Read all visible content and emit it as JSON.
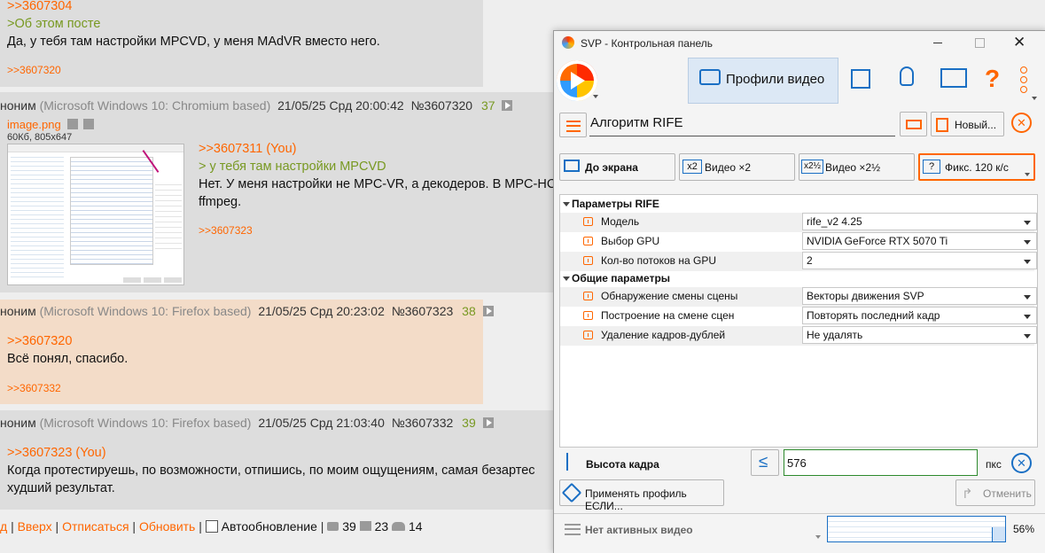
{
  "thread": {
    "post0": {
      "ref_top": ">>3607304",
      "quote_label": ">Об этом посте",
      "text": "Да, у тебя там настройки MPCVD, у меня MAdVR вместо него.",
      "reply_ref": ">>3607320"
    },
    "post1": {
      "author": "нонимм",
      "author_display": "ноним",
      "os": "(Microsoft Windows 10: Chromium based)",
      "date": "21/05/25 Срд 20:00:42",
      "num": "№3607320",
      "replies": "37",
      "file_name": "image.png",
      "file_meta": "60Кб, 805x647",
      "ref": ">>3607311 (You)",
      "quote": "> у тебя там настройки MPCVD",
      "text1": "Нет. У меня настройки не MPC-VR, а декодеров. В MPC-HC",
      "text2": "ffmpeg.",
      "reply_ref": ">>3607323"
    },
    "post2": {
      "author_display": "ноним",
      "os": "(Microsoft Windows 10: Firefox based)",
      "date": "21/05/25 Срд 20:23:02",
      "num": "№3607323",
      "replies": "38",
      "ref": ">>3607320",
      "text": "Всё понял, спасибо.",
      "reply_ref": ">>3607332"
    },
    "post3": {
      "author_display": "ноним",
      "os": "(Microsoft Windows 10: Firefox based)",
      "date": "21/05/25 Срд 21:03:40",
      "num": "№3607332",
      "replies": "39",
      "ref": ">>3607323 (You)",
      "text1": "Когда протестируешь, по возможности, отпишись, по моим ощущениям, самая безартес",
      "text2": "худший результат."
    },
    "footer": {
      "first": "д",
      "up": "Вверх",
      "unsubscribe": "Отписаться",
      "refresh": "Обновить",
      "autoupdate": "Автообновление",
      "posts_count": "39",
      "images_count": "23",
      "users_count": "14"
    }
  },
  "svp": {
    "title": "SVP - Контрольная панель",
    "tab_active": "Профили видео",
    "profile_name": "Алгоритм RIFE",
    "new_button": "Новый...",
    "modes": [
      "До экрана",
      "Видео ×2",
      "Видео ×2½",
      "Фикс. 120 к/с"
    ],
    "mode_badges": [
      "",
      "x2",
      "x2½",
      "?"
    ],
    "section1": "Параметры RIFE",
    "section2": "Общие параметры",
    "rows": [
      {
        "label": "Модель",
        "value": "rife_v2 4.25"
      },
      {
        "label": "Выбор GPU",
        "value": "NVIDIA GeForce RTX 5070 Ti"
      },
      {
        "label": "Кол-во потоков на GPU",
        "value": "2"
      },
      {
        "label": "Обнаружение смены сцены",
        "value": "Векторы движения SVP"
      },
      {
        "label": "Построение на смене сцен",
        "value": "Повторять последний кадр"
      },
      {
        "label": "Удаление кадров-дублей",
        "value": "Не удалять"
      }
    ],
    "frame_height_label": "Высота кадра",
    "frame_height_value": "576",
    "frame_height_unit": "пкс",
    "apply_if": "Применять профиль ЕСЛИ...",
    "cancel": "Отменить",
    "status": "Нет активных видео",
    "cpu_percent": "56%",
    "cpu_fraction": 0.56,
    "colors": {
      "accent": "#ff6600",
      "tab_bg": "#dce8f5",
      "green_border": "#2d8a2d",
      "blue": "#1a6fc4"
    }
  }
}
